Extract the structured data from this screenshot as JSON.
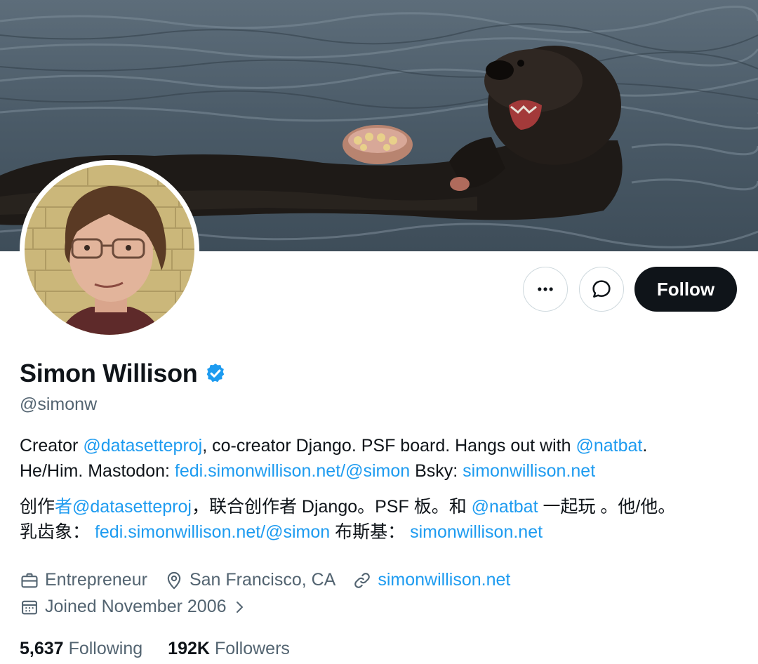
{
  "profile": {
    "display_name": "Simon Willison",
    "handle": "@simonw",
    "verified_icon": "verified-badge-icon"
  },
  "actions": {
    "more_icon": "more-icon",
    "message_icon": "message-icon",
    "follow_label": "Follow"
  },
  "bio": {
    "line1": {
      "t1": "Creator ",
      "l1": "@datasetteproj",
      "t2": ", co-creator Django. PSF board. Hangs out with ",
      "l2": "@natbat",
      "t3": "."
    },
    "line2": {
      "t1": "He/Him. Mastodon: ",
      "l1": "fedi.simonwillison.net/@simon",
      "t2": " Bsky: ",
      "l2": "simonwillison.net"
    },
    "line3": {
      "t1": "创作",
      "l1": "者@datasetteproj",
      "t2": "，联合创作者 Django。PSF 板。和 ",
      "l2": "@natbat",
      "t3": " 一起玩 。他/他。"
    },
    "line4": {
      "t1": "乳齿象： ",
      "l1": "fedi.simonwillison.net/@simon",
      "t2": " 布斯基： ",
      "l2": "simonwillison.net"
    }
  },
  "meta": {
    "profession": "Entrepreneur",
    "location": "San Francisco, CA",
    "website": "simonwillison.net",
    "joined": "Joined November 2006"
  },
  "stats": {
    "following_count": "5,637",
    "following_label": "Following",
    "followers_count": "192K",
    "followers_label": "Followers"
  },
  "colors": {
    "link": "#1d9bf0",
    "secondary_text": "#536471",
    "follow_bg": "#0f1419"
  }
}
